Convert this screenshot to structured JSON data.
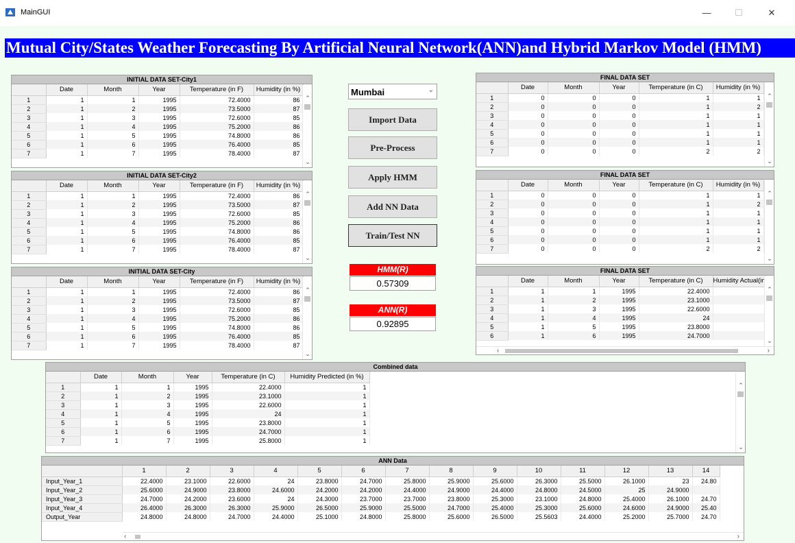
{
  "window": {
    "title": "MainGUI",
    "minimize": "—",
    "maximize": "☐",
    "close": "✕"
  },
  "banner": "Mutual City/States Weather Forecasting By Artificial Neural Network(ANN)and Hybrid Markov Model (HMM)",
  "city_select": {
    "value": "Mumbai"
  },
  "buttons": {
    "import": "Import Data",
    "preprocess": "Pre-Process",
    "apply_hmm": "Apply HMM",
    "add_nn": "Add NN Data",
    "train_test": "Train/Test NN"
  },
  "metrics": {
    "hmm_label": "HMM(R)",
    "hmm_value": "0.57309",
    "ann_label": "ANN(R)",
    "ann_value": "0.92895"
  },
  "city1": {
    "title": "INITIAL DATA SET-City1",
    "headers": [
      "",
      "Date",
      "Month",
      "Year",
      "Temperature (in F)",
      "Humidity (in %)"
    ],
    "rows": [
      [
        "1",
        "1",
        "1",
        "1995",
        "72.4000",
        "86"
      ],
      [
        "2",
        "1",
        "2",
        "1995",
        "73.5000",
        "87"
      ],
      [
        "3",
        "1",
        "3",
        "1995",
        "72.6000",
        "85"
      ],
      [
        "4",
        "1",
        "4",
        "1995",
        "75.2000",
        "86"
      ],
      [
        "5",
        "1",
        "5",
        "1995",
        "74.8000",
        "86"
      ],
      [
        "6",
        "1",
        "6",
        "1995",
        "76.4000",
        "85"
      ],
      [
        "7",
        "1",
        "7",
        "1995",
        "78.4000",
        "87"
      ]
    ]
  },
  "city2": {
    "title": "INITIAL DATA SET-City2",
    "headers": [
      "",
      "Date",
      "Month",
      "Year",
      "Temperature (in F)",
      "Humidity (in %)"
    ],
    "rows": [
      [
        "1",
        "1",
        "1",
        "1995",
        "72.4000",
        "86"
      ],
      [
        "2",
        "1",
        "2",
        "1995",
        "73.5000",
        "87"
      ],
      [
        "3",
        "1",
        "3",
        "1995",
        "72.6000",
        "85"
      ],
      [
        "4",
        "1",
        "4",
        "1995",
        "75.2000",
        "86"
      ],
      [
        "5",
        "1",
        "5",
        "1995",
        "74.8000",
        "86"
      ],
      [
        "6",
        "1",
        "6",
        "1995",
        "76.4000",
        "85"
      ],
      [
        "7",
        "1",
        "7",
        "1995",
        "78.4000",
        "87"
      ]
    ]
  },
  "city": {
    "title": "INITIAL DATA SET-City",
    "headers": [
      "",
      "Date",
      "Month",
      "Year",
      "Temperature (in F)",
      "Humidity (in %)"
    ],
    "rows": [
      [
        "1",
        "1",
        "1",
        "1995",
        "72.4000",
        "86"
      ],
      [
        "2",
        "1",
        "2",
        "1995",
        "73.5000",
        "87"
      ],
      [
        "3",
        "1",
        "3",
        "1995",
        "72.6000",
        "85"
      ],
      [
        "4",
        "1",
        "4",
        "1995",
        "75.2000",
        "86"
      ],
      [
        "5",
        "1",
        "5",
        "1995",
        "74.8000",
        "86"
      ],
      [
        "6",
        "1",
        "6",
        "1995",
        "76.4000",
        "85"
      ],
      [
        "7",
        "1",
        "7",
        "1995",
        "78.4000",
        "87"
      ]
    ]
  },
  "final1": {
    "title": "FINAL DATA SET",
    "headers": [
      "",
      "Date",
      "Month",
      "Year",
      "Temperature (in C)",
      "Humidity (in %)"
    ],
    "rows": [
      [
        "1",
        "0",
        "0",
        "0",
        "1",
        "1"
      ],
      [
        "2",
        "0",
        "0",
        "0",
        "1",
        "2"
      ],
      [
        "3",
        "0",
        "0",
        "0",
        "1",
        "1"
      ],
      [
        "4",
        "0",
        "0",
        "0",
        "1",
        "1"
      ],
      [
        "5",
        "0",
        "0",
        "0",
        "1",
        "1"
      ],
      [
        "6",
        "0",
        "0",
        "0",
        "1",
        "1"
      ],
      [
        "7",
        "0",
        "0",
        "0",
        "2",
        "2"
      ]
    ]
  },
  "final2": {
    "title": "FINAL DATA SET",
    "headers": [
      "",
      "Date",
      "Month",
      "Year",
      "Temperature (in C)",
      "Humidity (in %)"
    ],
    "rows": [
      [
        "1",
        "0",
        "0",
        "0",
        "1",
        "1"
      ],
      [
        "2",
        "0",
        "0",
        "0",
        "1",
        "2"
      ],
      [
        "3",
        "0",
        "0",
        "0",
        "1",
        "1"
      ],
      [
        "4",
        "0",
        "0",
        "0",
        "1",
        "1"
      ],
      [
        "5",
        "0",
        "0",
        "0",
        "1",
        "1"
      ],
      [
        "6",
        "0",
        "0",
        "0",
        "1",
        "1"
      ],
      [
        "7",
        "0",
        "0",
        "0",
        "2",
        "2"
      ]
    ]
  },
  "final3": {
    "title": "FINAL DATA SET",
    "headers": [
      "",
      "Date",
      "Month",
      "Year",
      "Temperature (in C)",
      "Humidity Actual(in"
    ],
    "rows": [
      [
        "1",
        "1",
        "1",
        "1995",
        "22.4000",
        ""
      ],
      [
        "2",
        "1",
        "2",
        "1995",
        "23.1000",
        ""
      ],
      [
        "3",
        "1",
        "3",
        "1995",
        "22.6000",
        ""
      ],
      [
        "4",
        "1",
        "4",
        "1995",
        "24",
        ""
      ],
      [
        "5",
        "1",
        "5",
        "1995",
        "23.8000",
        ""
      ],
      [
        "6",
        "1",
        "6",
        "1995",
        "24.7000",
        ""
      ]
    ]
  },
  "combined": {
    "title": "Combined data",
    "headers": [
      "",
      "Date",
      "Month",
      "Year",
      "Temperature (in C)",
      "Humidity Predicted (in %)"
    ],
    "rows": [
      [
        "1",
        "1",
        "1",
        "1995",
        "22.4000",
        "1"
      ],
      [
        "2",
        "1",
        "2",
        "1995",
        "23.1000",
        "1"
      ],
      [
        "3",
        "1",
        "3",
        "1995",
        "22.6000",
        "1"
      ],
      [
        "4",
        "1",
        "4",
        "1995",
        "24",
        "1"
      ],
      [
        "5",
        "1",
        "5",
        "1995",
        "23.8000",
        "1"
      ],
      [
        "6",
        "1",
        "6",
        "1995",
        "24.7000",
        "1"
      ],
      [
        "7",
        "1",
        "7",
        "1995",
        "25.8000",
        "1"
      ]
    ]
  },
  "ann": {
    "title": "ANN Data",
    "headers": [
      "",
      "1",
      "2",
      "3",
      "4",
      "5",
      "6",
      "7",
      "8",
      "9",
      "10",
      "11",
      "12",
      "13",
      "14"
    ],
    "rows": [
      [
        "Input_Year_1",
        "22.4000",
        "23.1000",
        "22.6000",
        "24",
        "23.8000",
        "24.7000",
        "25.8000",
        "25.9000",
        "25.6000",
        "26.3000",
        "25.5000",
        "26.1000",
        "23",
        "24.80"
      ],
      [
        "Input_Year_2",
        "25.6000",
        "24.9000",
        "23.8000",
        "24.6000",
        "24.2000",
        "24.2000",
        "24.4000",
        "24.9000",
        "24.4000",
        "24.8000",
        "24.5000",
        "25",
        "24.9000",
        ""
      ],
      [
        "Input_Year_3",
        "24.7000",
        "24.2000",
        "23.6000",
        "24",
        "24.3000",
        "23.7000",
        "23.7000",
        "23.8000",
        "25.3000",
        "23.1000",
        "24.8000",
        "25.4000",
        "26.1000",
        "24.70"
      ],
      [
        "Input_Year_4",
        "26.4000",
        "26.3000",
        "26.3000",
        "25.9000",
        "26.5000",
        "25.9000",
        "25.5000",
        "24.7000",
        "25.4000",
        "25.3000",
        "25.6000",
        "24.6000",
        "24.9000",
        "25.40"
      ],
      [
        "Output_Year",
        "24.8000",
        "24.8000",
        "24.7000",
        "24.4000",
        "25.1000",
        "24.8000",
        "25.8000",
        "25.6000",
        "26.5000",
        "25.5603",
        "24.4000",
        "25.2000",
        "25.7000",
        "24.70"
      ]
    ]
  }
}
